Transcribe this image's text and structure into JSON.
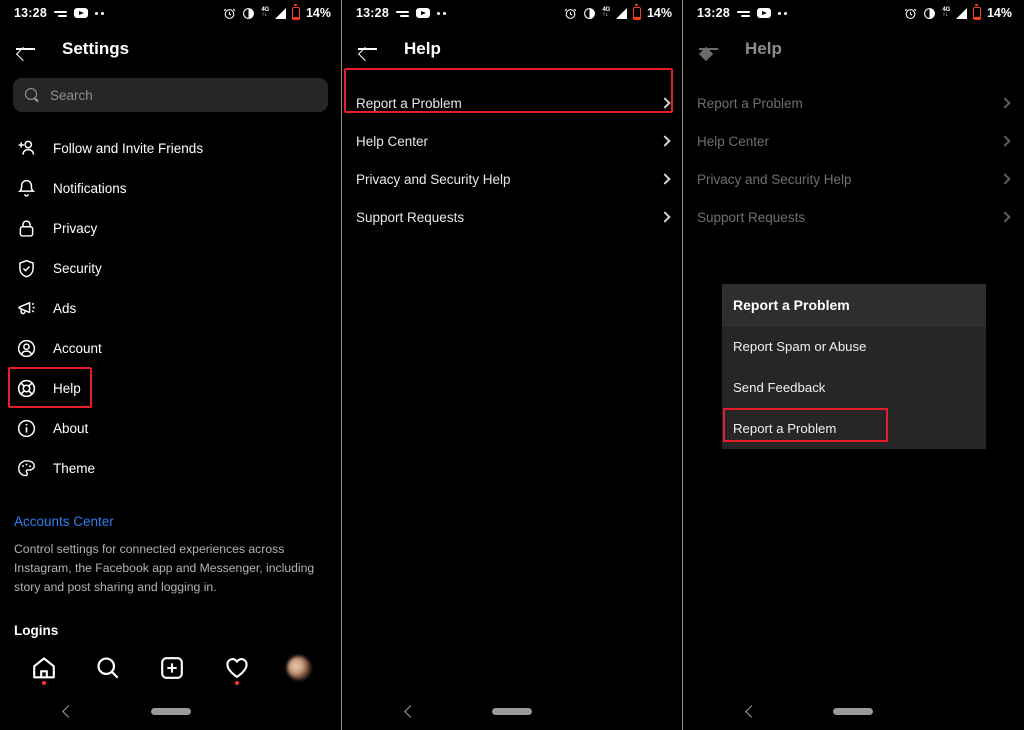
{
  "statusbar": {
    "time": "13:28",
    "battery_percent": "14%",
    "network": "4G",
    "icons": [
      "dash-icon",
      "youtube-icon",
      "more-dots-icon",
      "alarm-icon",
      "contrast-icon",
      "signal-icon",
      "battery-icon"
    ]
  },
  "panel1": {
    "title": "Settings",
    "back_icon": "back-arrow-icon",
    "search": {
      "placeholder": "Search",
      "icon": "search-icon"
    },
    "items": [
      {
        "label": "Follow and Invite Friends",
        "icon": "add-person-icon",
        "highlighted": false
      },
      {
        "label": "Notifications",
        "icon": "bell-icon",
        "highlighted": false
      },
      {
        "label": "Privacy",
        "icon": "lock-icon",
        "highlighted": false
      },
      {
        "label": "Security",
        "icon": "shield-check-icon",
        "highlighted": false
      },
      {
        "label": "Ads",
        "icon": "megaphone-icon",
        "highlighted": false
      },
      {
        "label": "Account",
        "icon": "person-circle-icon",
        "highlighted": false
      },
      {
        "label": "Help",
        "icon": "lifebuoy-icon",
        "highlighted": true
      },
      {
        "label": "About",
        "icon": "info-circle-icon",
        "highlighted": false
      },
      {
        "label": "Theme",
        "icon": "palette-icon",
        "highlighted": false
      }
    ],
    "accounts_center": {
      "link": "Accounts Center",
      "description": "Control settings for connected experiences across Instagram, the Facebook app and Messenger, including story and post sharing and logging in.",
      "next_section": "Logins"
    },
    "bottom_nav": [
      {
        "name": "home",
        "icon": "home-icon",
        "badge": true
      },
      {
        "name": "search",
        "icon": "search-icon",
        "badge": false
      },
      {
        "name": "create",
        "icon": "plus-square-icon",
        "badge": false
      },
      {
        "name": "activity",
        "icon": "heart-icon",
        "badge": true
      },
      {
        "name": "profile",
        "icon": "avatar-icon",
        "badge": false
      }
    ]
  },
  "panel2": {
    "title": "Help",
    "items": [
      {
        "label": "Report a Problem",
        "highlighted": true
      },
      {
        "label": "Help Center",
        "highlighted": false
      },
      {
        "label": "Privacy and Security Help",
        "highlighted": false
      },
      {
        "label": "Support Requests",
        "highlighted": false
      }
    ]
  },
  "panel3": {
    "title": "Help",
    "items": [
      {
        "label": "Report a Problem"
      },
      {
        "label": "Help Center"
      },
      {
        "label": "Privacy and Security Help"
      },
      {
        "label": "Support Requests"
      }
    ],
    "dialog": {
      "title": "Report a Problem",
      "options": [
        {
          "label": "Report Spam or Abuse",
          "highlighted": false
        },
        {
          "label": "Send Feedback",
          "highlighted": false
        },
        {
          "label": "Report a Problem",
          "highlighted": true
        }
      ]
    }
  },
  "android_nav": {
    "back": "back-chevron-icon",
    "home_pill": "home-pill-icon"
  },
  "colors": {
    "accent_red": "#e81d27",
    "link_blue": "#2d7ff0",
    "battery_red": "#ff3b1f",
    "surface": "#262626"
  }
}
